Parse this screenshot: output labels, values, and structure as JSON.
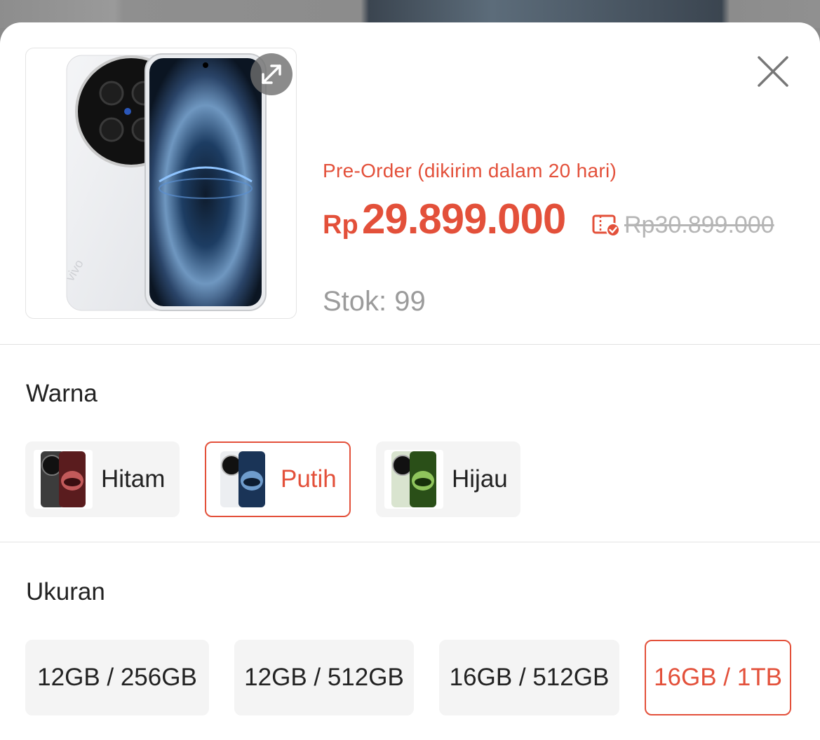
{
  "product": {
    "preorder_text": "Pre-Order (dikirim dalam 20 hari)",
    "price_currency": "Rp",
    "price_value": "29.899.000",
    "price_original": "Rp30.899.000",
    "stock_text": "Stok: 99",
    "image_icon": "phone-product-image",
    "expand_icon": "expand-icon",
    "close_icon": "close-icon",
    "voucher_icon": "voucher-check-icon"
  },
  "colors": {
    "accent": "#e3503a",
    "text": "#222222",
    "muted": "#9b9b9b",
    "chip_bg": "#f4f4f4"
  },
  "variant_color": {
    "label": "Warna",
    "options": [
      {
        "label": "Hitam",
        "selected": false
      },
      {
        "label": "Putih",
        "selected": true
      },
      {
        "label": "Hijau",
        "selected": false
      }
    ]
  },
  "variant_size": {
    "label": "Ukuran",
    "options": [
      {
        "label": "12GB / 256GB",
        "selected": false
      },
      {
        "label": "12GB / 512GB",
        "selected": false
      },
      {
        "label": "16GB / 512GB",
        "selected": false
      },
      {
        "label": "16GB / 1TB",
        "selected": true
      }
    ]
  }
}
